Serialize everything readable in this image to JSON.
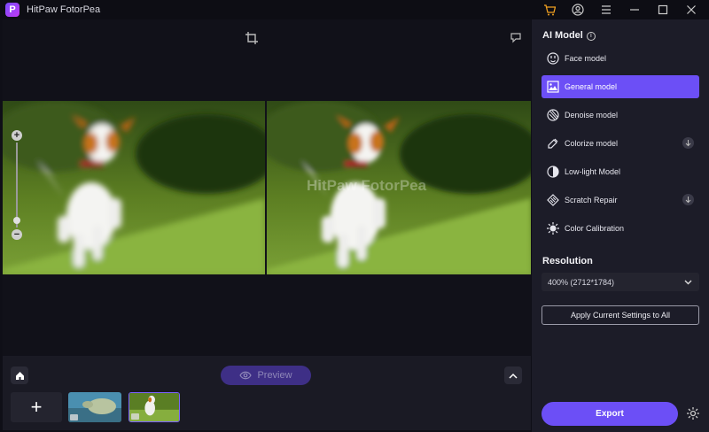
{
  "app": {
    "title": "HitPaw FotorPea",
    "logo_letter": "P",
    "accent": "#6c4ff6"
  },
  "titlebar": {
    "icons": [
      "cart-icon",
      "account-icon",
      "menu-icon",
      "minimize-icon",
      "maximize-icon",
      "close-icon"
    ]
  },
  "canvas": {
    "watermark": "HitPaw FotorPea",
    "zoom_in_symbol": "+",
    "zoom_out_symbol": "−",
    "zoom_level": 0.1
  },
  "bottom": {
    "preview_label": "Preview",
    "add_symbol": "+"
  },
  "panel": {
    "ai_model_heading": "AI Model",
    "models": [
      {
        "label": "Face model",
        "icon": "face-icon",
        "active": false,
        "download": false
      },
      {
        "label": "General model",
        "icon": "image-icon",
        "active": true,
        "download": false
      },
      {
        "label": "Denoise model",
        "icon": "denoise-icon",
        "active": false,
        "download": false
      },
      {
        "label": "Colorize model",
        "icon": "colorize-icon",
        "active": false,
        "download": true
      },
      {
        "label": "Low-light Model",
        "icon": "low-light-icon",
        "active": false,
        "download": false
      },
      {
        "label": "Scratch Repair",
        "icon": "scratch-icon",
        "active": false,
        "download": true
      },
      {
        "label": "Color Calibration",
        "icon": "calibration-icon",
        "active": false,
        "download": false
      }
    ],
    "resolution_heading": "Resolution",
    "resolution_value": "400% (2712*1784)",
    "apply_label": "Apply Current Settings to All",
    "export_label": "Export"
  }
}
